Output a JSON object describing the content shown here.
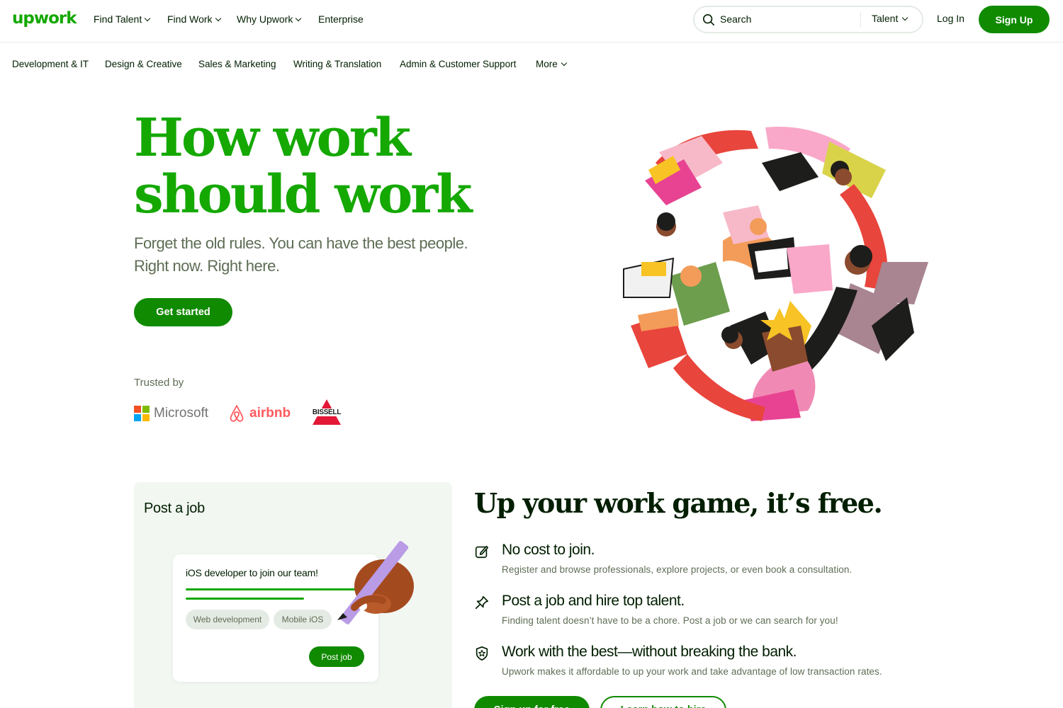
{
  "brand": {
    "logo": "upwork",
    "accent": "#14a800",
    "button_green": "#108a00"
  },
  "topnav": {
    "items": [
      {
        "label": "Find Talent",
        "has_caret": true
      },
      {
        "label": "Find Work",
        "has_caret": true
      },
      {
        "label": "Why Upwork",
        "has_caret": true
      },
      {
        "label": "Enterprise",
        "has_caret": false
      }
    ],
    "search": {
      "placeholder": "Search",
      "scope": "Talent",
      "icon": "search-icon"
    },
    "login": "Log In",
    "signup": "Sign Up"
  },
  "subnav": {
    "items": [
      "Development & IT",
      "Design & Creative",
      "Sales & Marketing",
      "Writing & Translation",
      "Admin & Customer Support",
      "More"
    ]
  },
  "hero": {
    "title_line1": "How work",
    "title_line2": "should work",
    "subtitle_line1": "Forget the old rules. You can have the best people.",
    "subtitle_line2": "Right now. Right here.",
    "cta": "Get started",
    "trusted_by": "Trusted by",
    "logos": [
      {
        "name": "Microsoft",
        "colors": [
          "#f25022",
          "#7fba00",
          "#00a4ef",
          "#ffb900"
        ]
      },
      {
        "name": "airbnb",
        "color": "#ff5a5f"
      },
      {
        "name": "BISSELL",
        "color": "#e31837"
      }
    ]
  },
  "post_job_card": {
    "title": "Post a job",
    "inner_title": "iOS developer to join our team!",
    "chips": [
      "Web development",
      "Mobile iOS"
    ],
    "button": "Post job"
  },
  "features": {
    "title": "Up your work game, it’s free.",
    "items": [
      {
        "icon": "edit-icon",
        "heading": "No cost to join.",
        "body": "Register and browse professionals, explore projects, or even book a consultation."
      },
      {
        "icon": "pin-icon",
        "heading": "Post a job and hire top talent.",
        "body": "Finding talent doesn’t have to be a chore. Post a job or we can search for you!"
      },
      {
        "icon": "shield-star-icon",
        "heading": "Work with the best—without breaking the bank.",
        "body": "Upwork makes it affordable to up your work and take advantage of low transaction rates."
      }
    ],
    "cta_primary": "Sign up for free",
    "cta_secondary": "Learn how to hire"
  }
}
